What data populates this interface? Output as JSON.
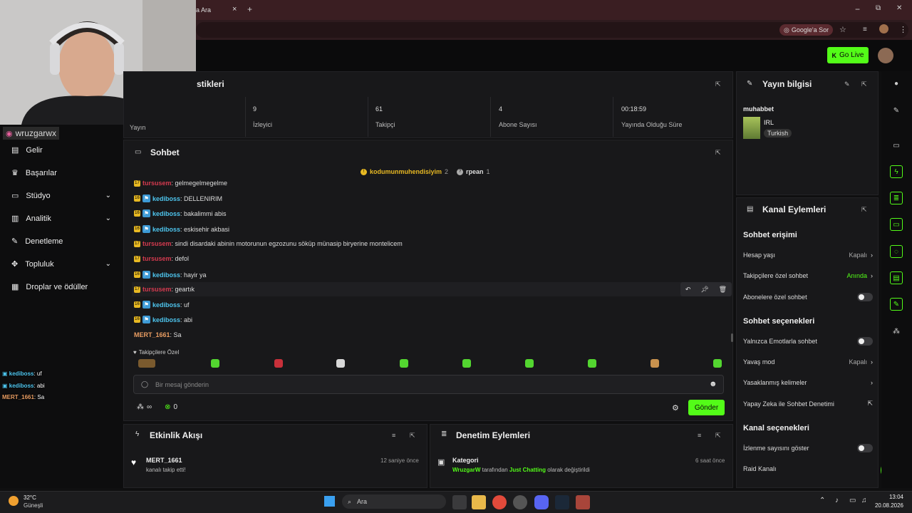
{
  "browser": {
    "tab_title": "a Ara",
    "google_btn": "Google'a Sor",
    "new_tab": "+",
    "tab_close": "×",
    "win_min": "−",
    "win_max": "⧉",
    "win_close": "✕"
  },
  "header": {
    "go_live": "Go Live"
  },
  "streamer": {
    "instagram": "wruzgarwx"
  },
  "sidebar": {
    "items": [
      {
        "label": "Gelir"
      },
      {
        "label": "Başarılar"
      },
      {
        "label": "Stüdyo"
      },
      {
        "label": "Analitik"
      },
      {
        "label": "Denetleme"
      },
      {
        "label": "Topluluk"
      },
      {
        "label": "Droplar ve ödüller"
      }
    ]
  },
  "overlay_chat": [
    {
      "user": "kediboss",
      "text": ": uf"
    },
    {
      "user": "kediboss",
      "text": ": abi"
    },
    {
      "user": "MERT_1661",
      "text": ": Sa"
    }
  ],
  "stats_panel": {
    "title_partial": "stikleri",
    "cells": [
      {
        "value": "",
        "label": "Yayın"
      },
      {
        "value": "9",
        "label": "İzleyici"
      },
      {
        "value": "61",
        "label": "Takipçi"
      },
      {
        "value": "4",
        "label": "Abone Sayısı"
      },
      {
        "value": "00:18:59",
        "label": "Yayında Olduğu Süre"
      }
    ]
  },
  "chat": {
    "title": "Sohbet",
    "pinned": [
      {
        "user": "kodumunmuhendisiyim",
        "count": "2"
      },
      {
        "user": "rpean",
        "count": "1"
      }
    ],
    "messages": [
      {
        "badge": "17",
        "user": "tursusem",
        "text": ": gelmegelmegelme",
        "color": "red",
        "kick": false
      },
      {
        "badge": "16",
        "user": "kediboss",
        "text": ": DELLENIRIM",
        "color": "blue",
        "kick": true
      },
      {
        "badge": "16",
        "user": "kediboss",
        "text": ": bakalimmi abis",
        "color": "blue",
        "kick": true
      },
      {
        "badge": "16",
        "user": "kediboss",
        "text": ": eskisehir akbasi",
        "color": "blue",
        "kick": true
      },
      {
        "badge": "17",
        "user": "tursusem",
        "text": ": sindi disardaki abinin motorunun egzozunu söküp münasip biryerine montelicem",
        "color": "red",
        "kick": false
      },
      {
        "badge": "17",
        "user": "tursusem",
        "text": ": defol",
        "color": "red",
        "kick": false
      },
      {
        "badge": "16",
        "user": "kediboss",
        "text": ": hayir ya",
        "color": "blue",
        "kick": true
      },
      {
        "badge": "17",
        "user": "tursusem",
        "text": ": geartık",
        "color": "red",
        "kick": false
      },
      {
        "badge": "16",
        "user": "kediboss",
        "text": ": uf",
        "color": "blue",
        "kick": true
      },
      {
        "badge": "16",
        "user": "kediboss",
        "text": ": abi",
        "color": "blue",
        "kick": true
      },
      {
        "badge": "",
        "user": "MERT_1661",
        "text": ": Sa",
        "color": "orange",
        "kick": false
      }
    ],
    "followers_only_label": "Takipçilere Özel",
    "input_placeholder": "Bir mesaj gönderin",
    "infinity": "∞",
    "points": "0",
    "send_label": "Gönder"
  },
  "stream_info": {
    "title": "Yayın bilgisi",
    "stream_title": "muhabbet",
    "category": "IRL",
    "language": "Turkish"
  },
  "channel_actions": {
    "title": "Kanal Eylemleri",
    "sections": [
      {
        "heading": "Sohbet erişimi",
        "rows": [
          {
            "label": "Hesap yaşı",
            "value": "Kapalı",
            "control": "chevron"
          },
          {
            "label": "Takipçilere özel sohbet",
            "value": "Anında",
            "control": "chevron"
          },
          {
            "label": "Abonelere özel sohbet",
            "value": "",
            "control": "toggle"
          }
        ]
      },
      {
        "heading": "Sohbet seçenekleri",
        "rows": [
          {
            "label": "Yalnızca Emotlarla sohbet",
            "value": "",
            "control": "toggle"
          },
          {
            "label": "Yavaş mod",
            "value": "Kapalı",
            "control": "chevron"
          },
          {
            "label": "Yasaklanmış kelimeler",
            "value": "",
            "control": "chevron"
          },
          {
            "label": "Yapay Zeka ile Sohbet Denetimi",
            "value": "",
            "control": "external"
          }
        ]
      },
      {
        "heading": "Kanal seçenekleri",
        "rows": [
          {
            "label": "İzlenme sayısını göster",
            "value": "",
            "control": "toggle"
          },
          {
            "label": "Raid Kanalı",
            "value": "",
            "control": "none"
          }
        ]
      }
    ]
  },
  "activity_feed": {
    "title": "Etkinlik Akışı",
    "items": [
      {
        "user": "MERT_1661",
        "text": "kanalı takip etti!",
        "time": "12 saniye önce"
      }
    ]
  },
  "mod_actions": {
    "title": "Denetim Eylemleri",
    "items": [
      {
        "type": "Kategori",
        "actor": "WruzgarW",
        "mid": " tarafından ",
        "target": "Just Chatting",
        "end": " olarak değiştirildi",
        "time": "6 saat önce"
      }
    ]
  },
  "taskbar": {
    "temp": "32°C",
    "weather": "Güneşli",
    "search": "Ara",
    "time": "13:04",
    "date": "20.08.2026"
  },
  "colors": {
    "accent": "#53fc18",
    "user_red": "#d43a4f",
    "user_blue": "#4ec5ee",
    "user_orange": "#e99d62"
  }
}
